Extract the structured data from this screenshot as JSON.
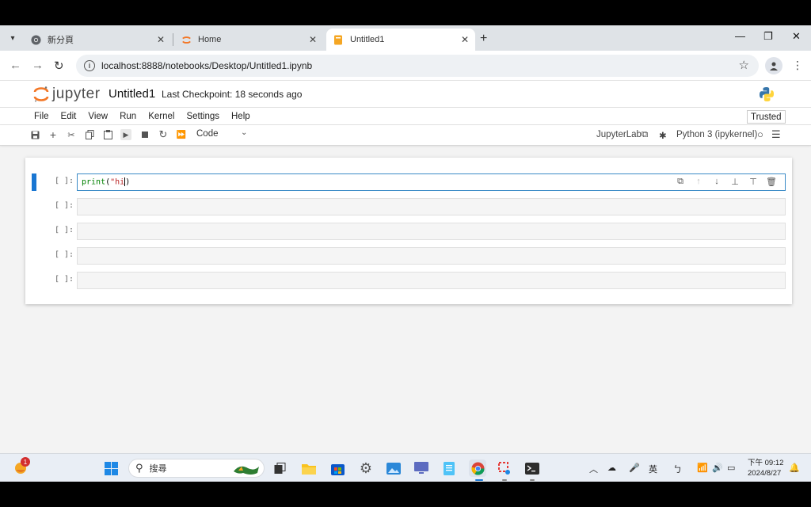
{
  "browser": {
    "tabs": [
      {
        "label": "新分頁"
      },
      {
        "label": "Home"
      },
      {
        "label": "Untitled1"
      }
    ],
    "url": "localhost:8888/notebooks/Desktop/Untitled1.ipynb"
  },
  "jupyter": {
    "logo_text": "jupyter",
    "notebook_title": "Untitled1",
    "checkpoint": "Last Checkpoint: 18 seconds ago",
    "menu": [
      "File",
      "Edit",
      "View",
      "Run",
      "Kernel",
      "Settings",
      "Help"
    ],
    "trusted": "Trusted",
    "cell_type": "Code",
    "jupyterlab_link": "JupyterLab",
    "kernel": "Python 3 (ipykernel)",
    "cells": [
      {
        "prompt": "[ ]:",
        "code_fn": "print",
        "code_rest_1": "(",
        "code_str": "\"hi",
        "code_rest_2": ")"
      },
      {
        "prompt": "[ ]:"
      },
      {
        "prompt": "[ ]:"
      },
      {
        "prompt": "[ ]:"
      },
      {
        "prompt": "[ ]:"
      }
    ]
  },
  "taskbar": {
    "notification_count": "1",
    "search_placeholder": "搜尋",
    "ime_label": "英",
    "time": "下午 09:12",
    "date": "2024/8/27"
  },
  "colors": {
    "accent_blue": "#1976d2",
    "jupyter_orange": "#f37726"
  }
}
